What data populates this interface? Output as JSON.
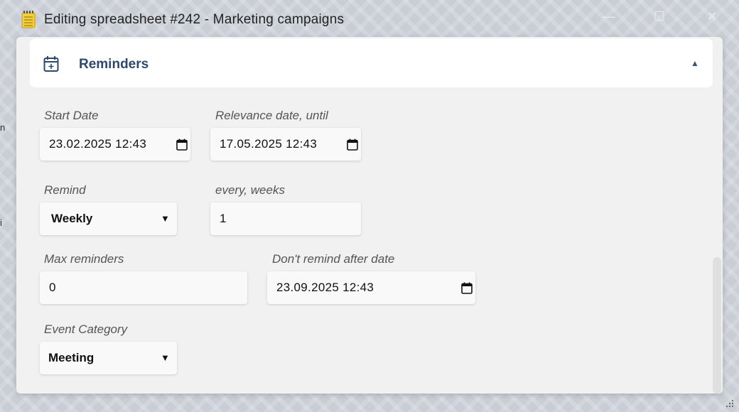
{
  "window": {
    "title": "Editing spreadsheet #242 - Marketing campaigns",
    "app_icon": "notepad-icon",
    "minimize_glyph": "—",
    "maximize_glyph": "☐",
    "close_glyph": "✕"
  },
  "background_marks": [
    "n",
    "i"
  ],
  "section": {
    "title": "Reminders",
    "icon": "calendar-plus-icon",
    "expanded": true,
    "collapse_glyph": "▲"
  },
  "form": {
    "start_date": {
      "label": "Start Date",
      "value": "23.02.2025 12:43"
    },
    "relevance_date": {
      "label": "Relevance date, until",
      "value": "17.05.2025 12:43"
    },
    "remind": {
      "label": "Remind",
      "value": "Weekly",
      "caret": "▼"
    },
    "every_weeks": {
      "label": "every, weeks",
      "value": "1"
    },
    "max_reminders": {
      "label": "Max reminders",
      "value": "0"
    },
    "dont_remind_after": {
      "label": "Don't remind after date",
      "value": "23.09.2025 12:43"
    },
    "event_category": {
      "label": "Event Category",
      "value": "Meeting",
      "caret": "▼"
    }
  },
  "colors": {
    "accent": "#2d4a6b",
    "dialog_bg": "#f1f1f1",
    "card_bg": "#ffffff"
  }
}
